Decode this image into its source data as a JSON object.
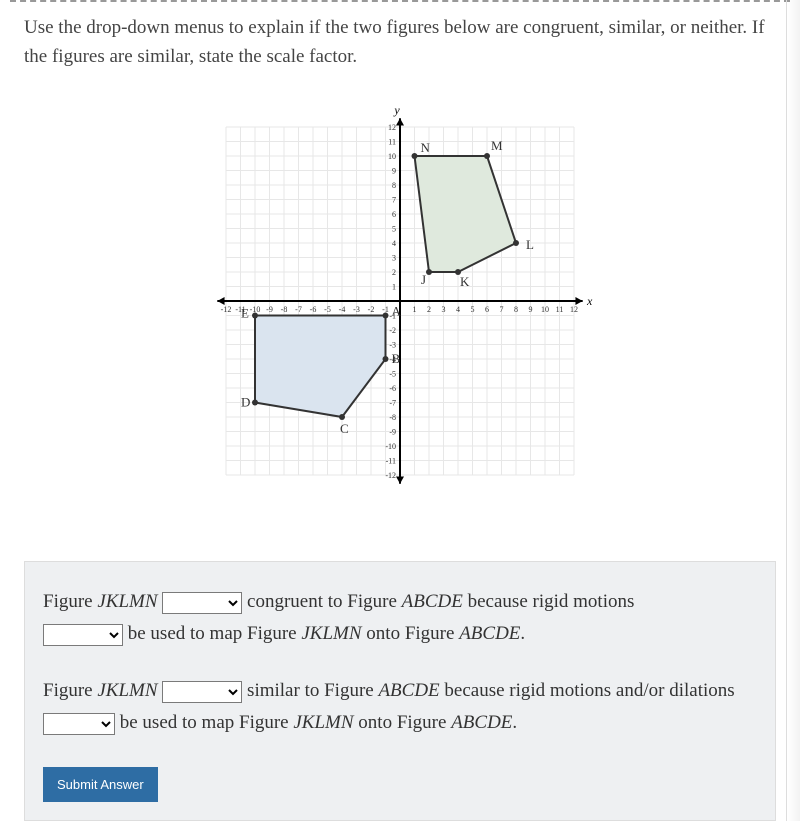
{
  "instructions": "Use the drop-down menus to explain if the two figures below are congruent, similar, or neither. If the figures are similar, state the scale factor.",
  "chart_data": {
    "type": "scatter",
    "title": "",
    "xlabel": "x",
    "ylabel": "y",
    "xlim": [
      -12,
      12
    ],
    "ylim": [
      -12,
      12
    ],
    "x_ticks": [
      -12,
      -11,
      -10,
      -9,
      -8,
      -7,
      -6,
      -5,
      -4,
      -3,
      -2,
      -1,
      1,
      2,
      3,
      4,
      5,
      6,
      7,
      8,
      9,
      10,
      11,
      12
    ],
    "y_ticks": [
      12,
      11,
      10,
      9,
      8,
      7,
      6,
      5,
      4,
      3,
      2,
      1,
      -1,
      -2,
      -3,
      -4,
      -5,
      -6,
      -7,
      -8,
      -9,
      -10,
      -11,
      -12
    ],
    "series": [
      {
        "name": "JKLMN",
        "type": "polygon",
        "fill": "#dfe9dd",
        "stroke": "#333",
        "points": [
          {
            "label": "J",
            "x": 2,
            "y": 2
          },
          {
            "label": "K",
            "x": 4,
            "y": 2
          },
          {
            "label": "L",
            "x": 8,
            "y": 4
          },
          {
            "label": "M",
            "x": 6,
            "y": 10
          },
          {
            "label": "N",
            "x": 1,
            "y": 10
          }
        ]
      },
      {
        "name": "ABCDE",
        "type": "polygon",
        "fill": "#dae4ef",
        "stroke": "#333",
        "points": [
          {
            "label": "A",
            "x": -1,
            "y": -1
          },
          {
            "label": "B",
            "x": -1,
            "y": -4
          },
          {
            "label": "C",
            "x": -4,
            "y": -8
          },
          {
            "label": "D",
            "x": -10,
            "y": -7
          },
          {
            "label": "E",
            "x": -10,
            "y": -1
          }
        ]
      }
    ]
  },
  "answer": {
    "line1_prefix": "Figure ",
    "fig1": "JKLMN",
    "line1_mid": " congruent to Figure ",
    "fig2": "ABCDE",
    "line1_suffix": " because rigid motions ",
    "line1b_suffix": " be used to map Figure ",
    "line1b_mid": " onto Figure ",
    "line1b_end": ".",
    "line2_prefix": "Figure ",
    "line2_mid": " similar to Figure ",
    "line2_suffix": " because rigid motions and/or dilations ",
    "line2b_suffix": " be used to map Figure ",
    "line2b_mid": " onto Figure ",
    "line2b_end": "."
  },
  "submit_label": "Submit Answer"
}
